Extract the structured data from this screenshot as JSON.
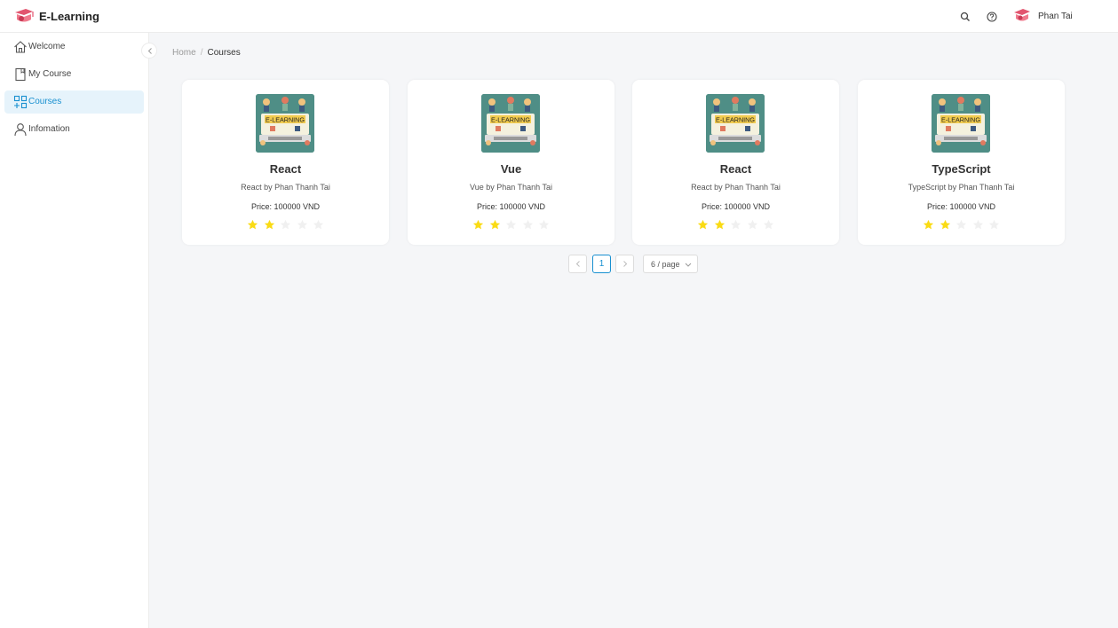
{
  "app": {
    "title": "E-Learning"
  },
  "header": {
    "user_name": "Phan Tai"
  },
  "sidebar": {
    "items": [
      {
        "label": "Welcome",
        "icon": "home-icon",
        "active": false
      },
      {
        "label": "My Course",
        "icon": "book-icon",
        "active": false
      },
      {
        "label": "Courses",
        "icon": "appstore-add-icon",
        "active": true
      },
      {
        "label": "Infomation",
        "icon": "user-icon",
        "active": false
      }
    ]
  },
  "breadcrumb": {
    "home": "Home",
    "separator": "/",
    "current": "Courses"
  },
  "courses": [
    {
      "title": "React",
      "subtitle": "React by Phan Thanh Tai",
      "price": "Price: 100000 VND",
      "rating": 2,
      "max_rating": 5,
      "thumb_text": "E-LEARNING"
    },
    {
      "title": "Vue",
      "subtitle": "Vue by Phan Thanh Tai",
      "price": "Price: 100000 VND",
      "rating": 2,
      "max_rating": 5,
      "thumb_text": "E-LEARNING"
    },
    {
      "title": "React",
      "subtitle": "React by Phan Thanh Tai",
      "price": "Price: 100000 VND",
      "rating": 2,
      "max_rating": 5,
      "thumb_text": "E-LEARNING"
    },
    {
      "title": "TypeScript",
      "subtitle": "TypeScript by Phan Thanh Tai",
      "price": "Price: 100000 VND",
      "rating": 2,
      "max_rating": 5,
      "thumb_text": "E-LEARNING"
    }
  ],
  "pagination": {
    "current_page": "1",
    "page_size": "6 / page"
  },
  "colors": {
    "accent": "#1890d0",
    "star_filled": "#fadb14",
    "star_empty": "#f0f0f0",
    "brand": "#e2556f"
  }
}
